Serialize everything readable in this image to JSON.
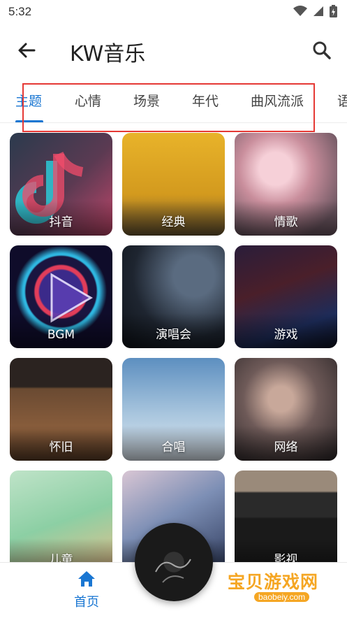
{
  "status_bar": {
    "time": "5:32",
    "icons": [
      "wifi-icon",
      "signal-icon",
      "battery-charging-icon"
    ]
  },
  "app_bar": {
    "back_icon": "arrow-left-icon",
    "title": "KW音乐",
    "search_icon": "search-icon"
  },
  "tabs": [
    {
      "label": "主题",
      "active": true
    },
    {
      "label": "心情",
      "active": false
    },
    {
      "label": "场景",
      "active": false
    },
    {
      "label": "年代",
      "active": false
    },
    {
      "label": "曲风流派",
      "active": false
    },
    {
      "label": "语",
      "active": false
    }
  ],
  "cards": [
    {
      "label": "抖音"
    },
    {
      "label": "经典"
    },
    {
      "label": "情歌"
    },
    {
      "label": "BGM"
    },
    {
      "label": "演唱会"
    },
    {
      "label": "游戏"
    },
    {
      "label": "怀旧"
    },
    {
      "label": "合唱"
    },
    {
      "label": "网络"
    },
    {
      "label": "儿童"
    },
    {
      "label": ""
    },
    {
      "label": "影视"
    }
  ],
  "bottom_nav": {
    "home_label": "首页",
    "home_icon": "home-icon"
  },
  "watermark": {
    "main": "宝贝游戏网",
    "sub": "baobeiy.com"
  },
  "colors": {
    "accent": "#1976d2",
    "highlight": "#e53935"
  }
}
